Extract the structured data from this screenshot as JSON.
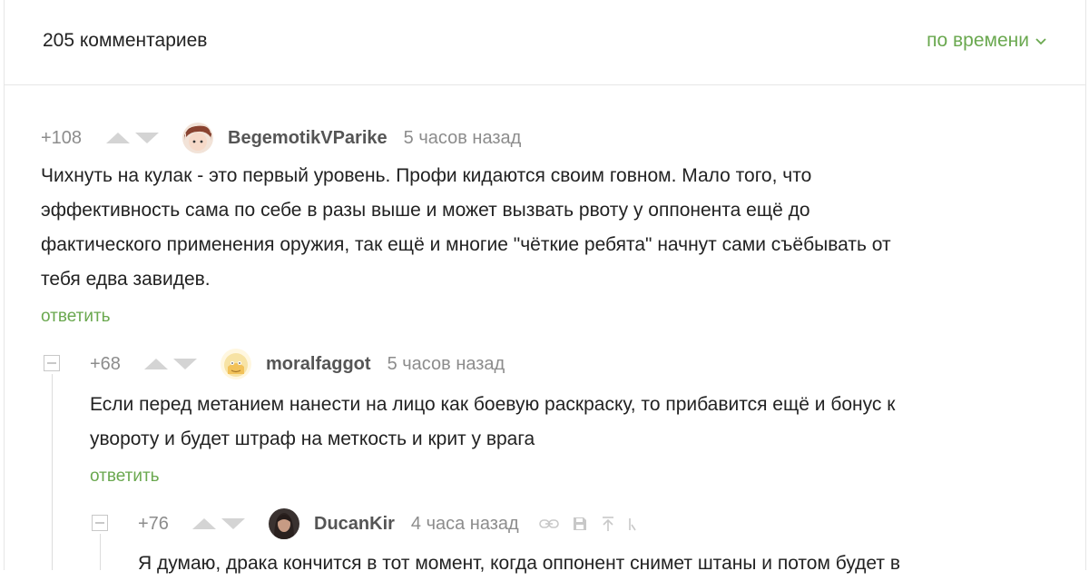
{
  "header": {
    "count_label": "205 комментариев",
    "sort_label": "по времени"
  },
  "comments": [
    {
      "rating": "+108",
      "username": "BegemotikVParike",
      "time": "5 часов назад",
      "text_lines": [
        "Чихнуть на кулак - это первый уровень. Профи кидаются своим говном. Мало того, что",
        "эффективность сама по себе в разы выше и может вызвать рвоту у оппонента ещё до",
        "фактического применения оружия, так ещё и многие \"чёткие ребята\" начнут сами съёбывать от",
        "тебя едва завидев."
      ],
      "reply_label": "ответить",
      "avatar": "brown-haired-avatar"
    },
    {
      "rating": "+68",
      "username": "moralfaggot",
      "time": "5 часов назад",
      "text_lines": [
        "Если перед метанием нанести на лицо как боевую раскраску, то прибавится ещё и бонус к",
        "увороту и будет штраф на меткость и крит у врага"
      ],
      "reply_label": "ответить",
      "avatar": "cartoon-face-avatar"
    },
    {
      "rating": "+76",
      "username": "DucanKir",
      "time": "4 часа назад",
      "text_lines": [
        "Я думаю, драка кончится в тот момент, когда оппонент снимет штаны и потом будет в"
      ],
      "avatar": "dark-portrait-avatar",
      "tools": [
        "link-icon",
        "save-icon",
        "upload-icon",
        "more-icon"
      ]
    }
  ],
  "colors": {
    "accent": "#6aa84f",
    "muted": "#8c8c8c",
    "text": "#222222"
  }
}
